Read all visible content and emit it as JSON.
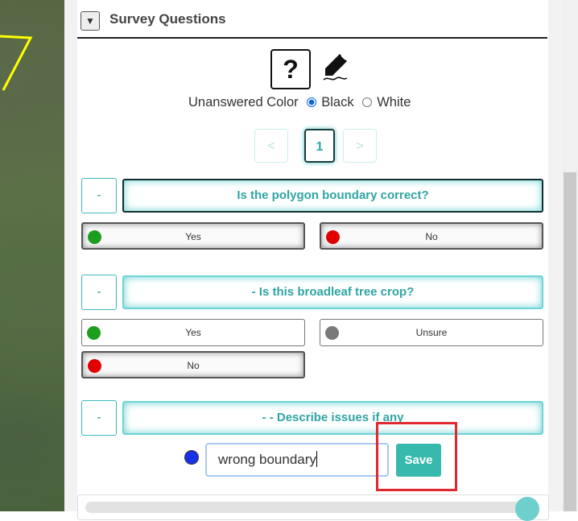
{
  "survey": {
    "title": "Survey Questions",
    "collapse_glyph": "▼",
    "help_glyph": "?",
    "unanswered_color_label": "Unanswered Color",
    "color_options": [
      {
        "label": "Black",
        "selected": true
      },
      {
        "label": "White",
        "selected": false
      }
    ],
    "pagination": {
      "prev": "<",
      "current": "1",
      "next": ">"
    },
    "collapse_label": "-",
    "questions": [
      {
        "text": "Is the polygon boundary correct?",
        "answers": [
          {
            "label": "Yes",
            "color": "#1e9e1e",
            "selected": true
          },
          {
            "label": "No",
            "color": "#e00000",
            "selected": true
          }
        ]
      },
      {
        "text": "- Is this broadleaf tree crop?",
        "answers": [
          {
            "label": "Yes",
            "color": "#1e9e1e",
            "selected": false
          },
          {
            "label": "Unsure",
            "color": "#7a7a7a",
            "selected": false
          },
          {
            "label": "No",
            "color": "#e00000",
            "selected": true
          }
        ]
      },
      {
        "text": "- - Describe issues if any",
        "input_value": "wrong boundary",
        "dot_color": "#1631e8",
        "save_label": "Save"
      }
    ]
  },
  "colors": {
    "accent": "#37b9ad",
    "highlight_box": "#e02830"
  }
}
